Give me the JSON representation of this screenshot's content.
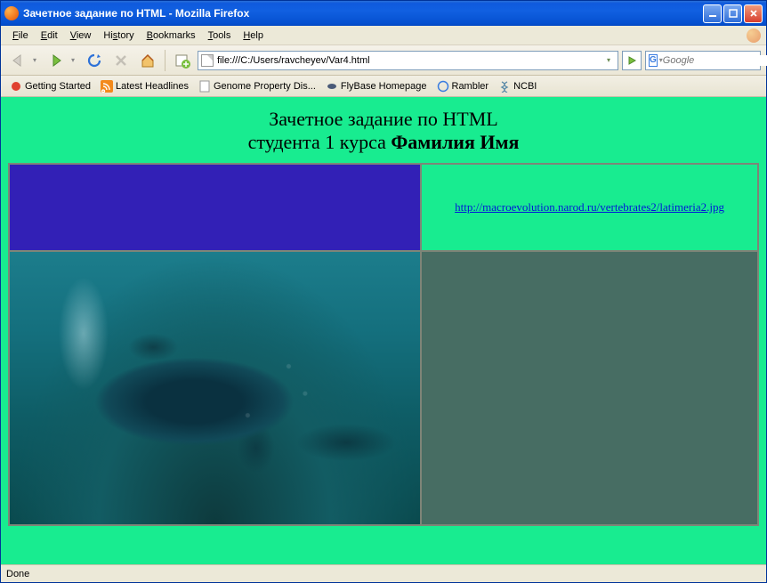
{
  "window": {
    "title": "Зачетное задание по HTML - Mozilla Firefox"
  },
  "menu": {
    "file": "File",
    "edit": "Edit",
    "view": "View",
    "history": "History",
    "bookmarks": "Bookmarks",
    "tools": "Tools",
    "help": "Help"
  },
  "toolbar": {
    "url": "file:///C:/Users/ravcheyev/Var4.html",
    "search_placeholder": "Google"
  },
  "bookmarks": [
    {
      "label": "Getting Started"
    },
    {
      "label": "Latest Headlines"
    },
    {
      "label": "Genome Property Dis..."
    },
    {
      "label": "FlyBase Homepage"
    },
    {
      "label": "Rambler"
    },
    {
      "label": "NCBI"
    }
  ],
  "page": {
    "heading_line1": "Зачетное задание по HTML",
    "heading_line2a": "студента 1 курса ",
    "heading_line2b": "Фамилия Имя",
    "link_text": "http://macroevolution.narod.ru/vertebrates2/latimeria2.jpg"
  },
  "status": {
    "text": "Done"
  }
}
